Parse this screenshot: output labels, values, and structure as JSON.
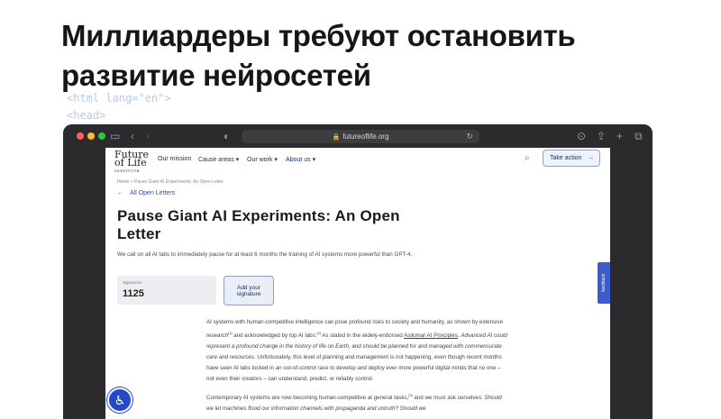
{
  "slide": {
    "title_line1": "Миллиардеры требуют остановить",
    "title_line2": "развитие нейросетей",
    "code_line1": "<html lang=\"en\">",
    "code_line2": "<head>"
  },
  "browser": {
    "url": "futureoflife.org",
    "icons": [
      "sidebar-icon",
      "back-icon",
      "forward-icon",
      "shield-icon",
      "lock-icon",
      "reload-icon",
      "download-icon",
      "share-icon",
      "new-tab-icon",
      "tabs-icon"
    ]
  },
  "site": {
    "logo_line1": "Future",
    "logo_line2": "of Life",
    "logo_line3": "INSTITUTE",
    "nav": [
      "Our mission",
      "Cause areas ▾",
      "Our work ▾",
      "About us ▾"
    ],
    "take_action": "Take action",
    "breadcrumb": "Home  >  Pause Giant AI Experiments: An Open Letter",
    "back_link": "All Open Letters",
    "heading": "Pause Giant AI Experiments: An Open Letter",
    "lead": "We call on all AI labs to immediately pause for at least 6 months the training of AI systems more powerful than GPT-4.",
    "signatures_label": "Signatures",
    "signatures_count": "1125",
    "add_signature": "Add your signature",
    "feedback": "feedback"
  },
  "article": {
    "p1_a": "AI systems with human-competitive intelligence can pose profound risks to society and humanity, as shown by extensive research",
    "p1_sup1": "[1]",
    "p1_b": " and acknowledged by top AI labs.",
    "p1_sup2": "[2]",
    "p1_c": " As stated in the widely-endorsed ",
    "p1_link": "Asilomar AI Principles",
    "p1_d": ", ",
    "p1_em": "Advanced AI could represent a profound change in the history of life on Earth, and should be planned for and managed with commensurate care and resources",
    "p1_e": ". Unfortunately, this level of planning and management is not happening, even though recent months have seen AI labs locked in an out-of-control race to develop and deploy ever more powerful digital minds that no one – not even their creators – can understand, predict, or reliably control.",
    "p2_a": "Contemporary AI systems are now becoming human-competitive at general tasks,",
    "p2_sup": "[3]",
    "p2_b": " and we must ask ourselves: ",
    "p2_em": "Should we let machines flood our information channels with propaganda and untruth? Should we"
  },
  "colors": {
    "accent": "#2a4faa",
    "window_chrome": "#2b2b2d",
    "a11y_button": "#2548c8"
  }
}
